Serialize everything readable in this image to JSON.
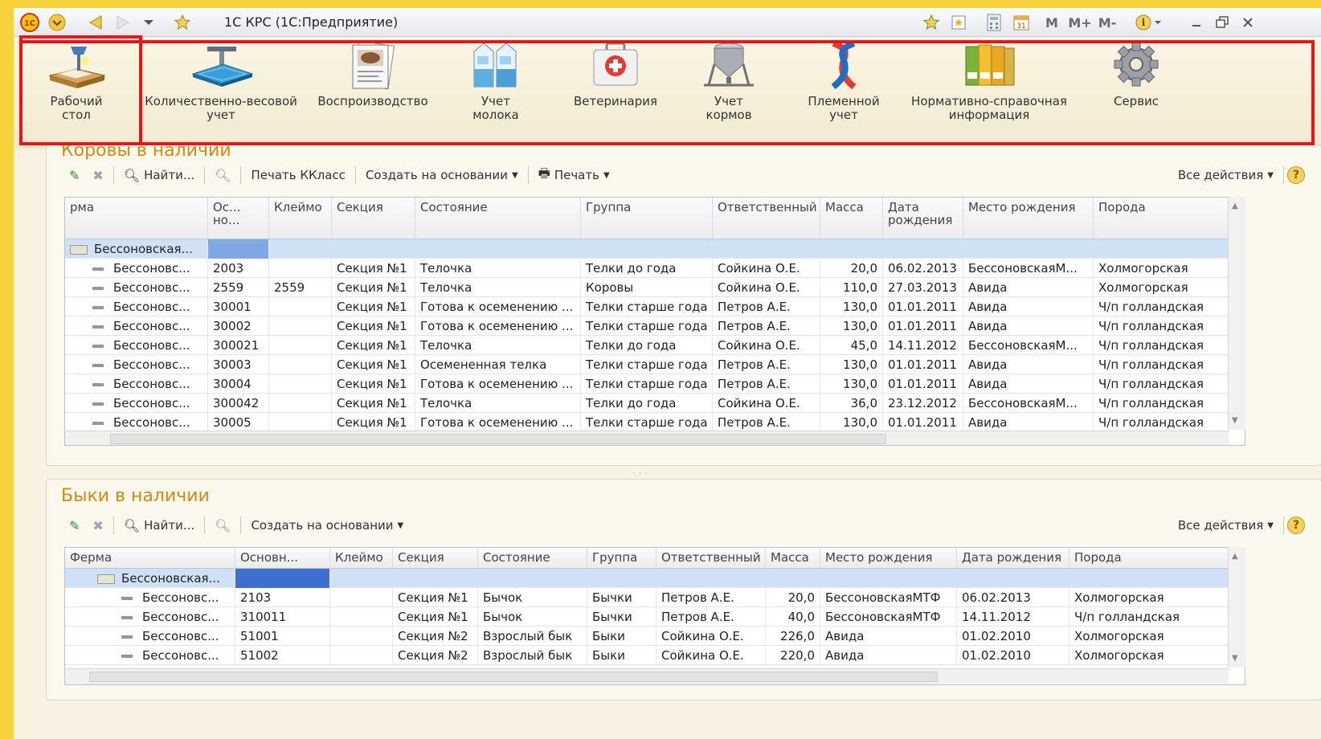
{
  "window": {
    "title": "1С КРС (1С:Предприятие)",
    "mem_buttons": [
      "M",
      "M+",
      "M-"
    ]
  },
  "sections": [
    {
      "label": "Рабочий\nстол",
      "icon": "desk-icon"
    },
    {
      "label": "Количественно-весовой\nучет",
      "icon": "scales-icon"
    },
    {
      "label": "Воспроизводство",
      "icon": "cow-card-icon"
    },
    {
      "label": "Учет\nмолока",
      "icon": "milk-icon"
    },
    {
      "label": "Ветеринария",
      "icon": "medkit-icon"
    },
    {
      "label": "Учет\nкормов",
      "icon": "silo-icon"
    },
    {
      "label": "Племенной\nучет",
      "icon": "dna-icon"
    },
    {
      "label": "Нормативно-справочная\nинформация",
      "icon": "binders-icon"
    },
    {
      "label": "Сервис",
      "icon": "gear-icon"
    }
  ],
  "cows": {
    "title": "Коровы в наличии",
    "toolbar": {
      "find": "Найти...",
      "print_kclass": "Печать ККласс",
      "create_based": "Создать на основании",
      "print": "Печать",
      "all_actions": "Все действия"
    },
    "columns": [
      "рма",
      "Ос...\nно...",
      "Клеймо",
      "Секция",
      "Состояние",
      "Группа",
      "Ответственный",
      "Масса",
      "Дата\nрождения",
      "Место рождения",
      "Порода"
    ],
    "group_row": "Бессоновская...",
    "rows": [
      [
        "Бессоновс...",
        "2003",
        "",
        "Секция №1",
        "Телочка",
        "Телки до года",
        "Сойкина О.Е.",
        "20,0",
        "06.02.2013",
        "БессоновскаяМ...",
        "Холмогорская"
      ],
      [
        "Бессоновс...",
        "2559",
        "2559",
        "Секция №1",
        "Телочка",
        "Коровы",
        "Сойкина О.Е.",
        "110,0",
        "27.03.2013",
        "Авида",
        "Холмогорская"
      ],
      [
        "Бессоновс...",
        "30001",
        "",
        "Секция №1",
        "Готова к осеменению ...",
        "Телки старше года",
        "Петров А.Е.",
        "130,0",
        "01.01.2011",
        "Авида",
        "Ч/п голландская"
      ],
      [
        "Бессоновс...",
        "30002",
        "",
        "Секция №1",
        "Готова к осеменению ...",
        "Телки старше года",
        "Петров А.Е.",
        "130,0",
        "01.01.2011",
        "Авида",
        "Ч/п голландская"
      ],
      [
        "Бессоновс...",
        "300021",
        "",
        "Секция №1",
        "Телочка",
        "Телки до года",
        "Сойкина О.Е.",
        "45,0",
        "14.11.2012",
        "БессоновскаяМ...",
        "Ч/п голландская"
      ],
      [
        "Бессоновс...",
        "30003",
        "",
        "Секция №1",
        "Осемененная телка",
        "Телки старше года",
        "Петров А.Е.",
        "130,0",
        "01.01.2011",
        "Авида",
        "Ч/п голландская"
      ],
      [
        "Бессоновс...",
        "30004",
        "",
        "Секция №1",
        "Готова к осеменению ...",
        "Телки старше года",
        "Петров А.Е.",
        "130,0",
        "01.01.2011",
        "Авида",
        "Ч/п голландская"
      ],
      [
        "Бессоновс...",
        "300042",
        "",
        "Секция №1",
        "Телочка",
        "Телки до года",
        "Сойкина О.Е.",
        "36,0",
        "23.12.2012",
        "БессоновскаяМ...",
        "Ч/п голландская"
      ],
      [
        "Бессоновс...",
        "30005",
        "",
        "Секция №1",
        "Готова к осеменению ...",
        "Телки старше года",
        "Петров А.Е.",
        "130,0",
        "01.01.2011",
        "Авида",
        "Ч/п голландская"
      ]
    ]
  },
  "bulls": {
    "title": "Быки в наличии",
    "toolbar": {
      "find": "Найти...",
      "create_based": "Создать на основании",
      "all_actions": "Все действия"
    },
    "columns": [
      "Ферма",
      "Основн...",
      "Клеймо",
      "Секция",
      "Состояние",
      "Группа",
      "Ответственный",
      "Масса",
      "Место рождения",
      "Дата рождения",
      "Порода"
    ],
    "group_row": "Бессоновская...",
    "rows": [
      [
        "Бессоновс...",
        "2103",
        "",
        "Секция №1",
        "Бычок",
        "Бычки",
        "Петров А.Е.",
        "20,0",
        "БессоновскаяМТФ",
        "06.02.2013",
        "Холмогорская"
      ],
      [
        "Бессоновс...",
        "310011",
        "",
        "Секция №1",
        "Бычок",
        "Бычки",
        "Петров А.Е.",
        "40,0",
        "БессоновскаяМТФ",
        "14.11.2012",
        "Ч/п голландская"
      ],
      [
        "Бессоновс...",
        "51001",
        "",
        "Секция №2",
        "Взрослый бык",
        "Быки",
        "Сойкина О.Е.",
        "226,0",
        "Авида",
        "01.02.2010",
        "Холмогорская"
      ],
      [
        "Бессоновс...",
        "51002",
        "",
        "Секция №2",
        "Взрослый бык",
        "Быки",
        "Сойкина О.Е.",
        "220,0",
        "Авида",
        "01.02.2010",
        "Холмогорская"
      ]
    ]
  },
  "colors": {
    "accent": "#d38a12",
    "highlight": "#e8141a",
    "selection": "#cfe1f6",
    "frame": "#f6d33c"
  }
}
